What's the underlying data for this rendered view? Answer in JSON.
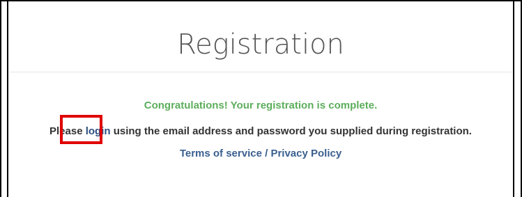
{
  "page": {
    "title": "Registration"
  },
  "message": {
    "success": "Congratulations! Your registration is complete.",
    "instruction_prefix": "Please ",
    "login_label": "login",
    "instruction_suffix": " using the email address and password you supplied during registration."
  },
  "footer": {
    "terms_label": "Terms of service",
    "separator": " / ",
    "privacy_label": "Privacy Policy"
  },
  "colors": {
    "success": "#5cae5c",
    "link": "#2b4f80",
    "highlight": "#e00000"
  }
}
